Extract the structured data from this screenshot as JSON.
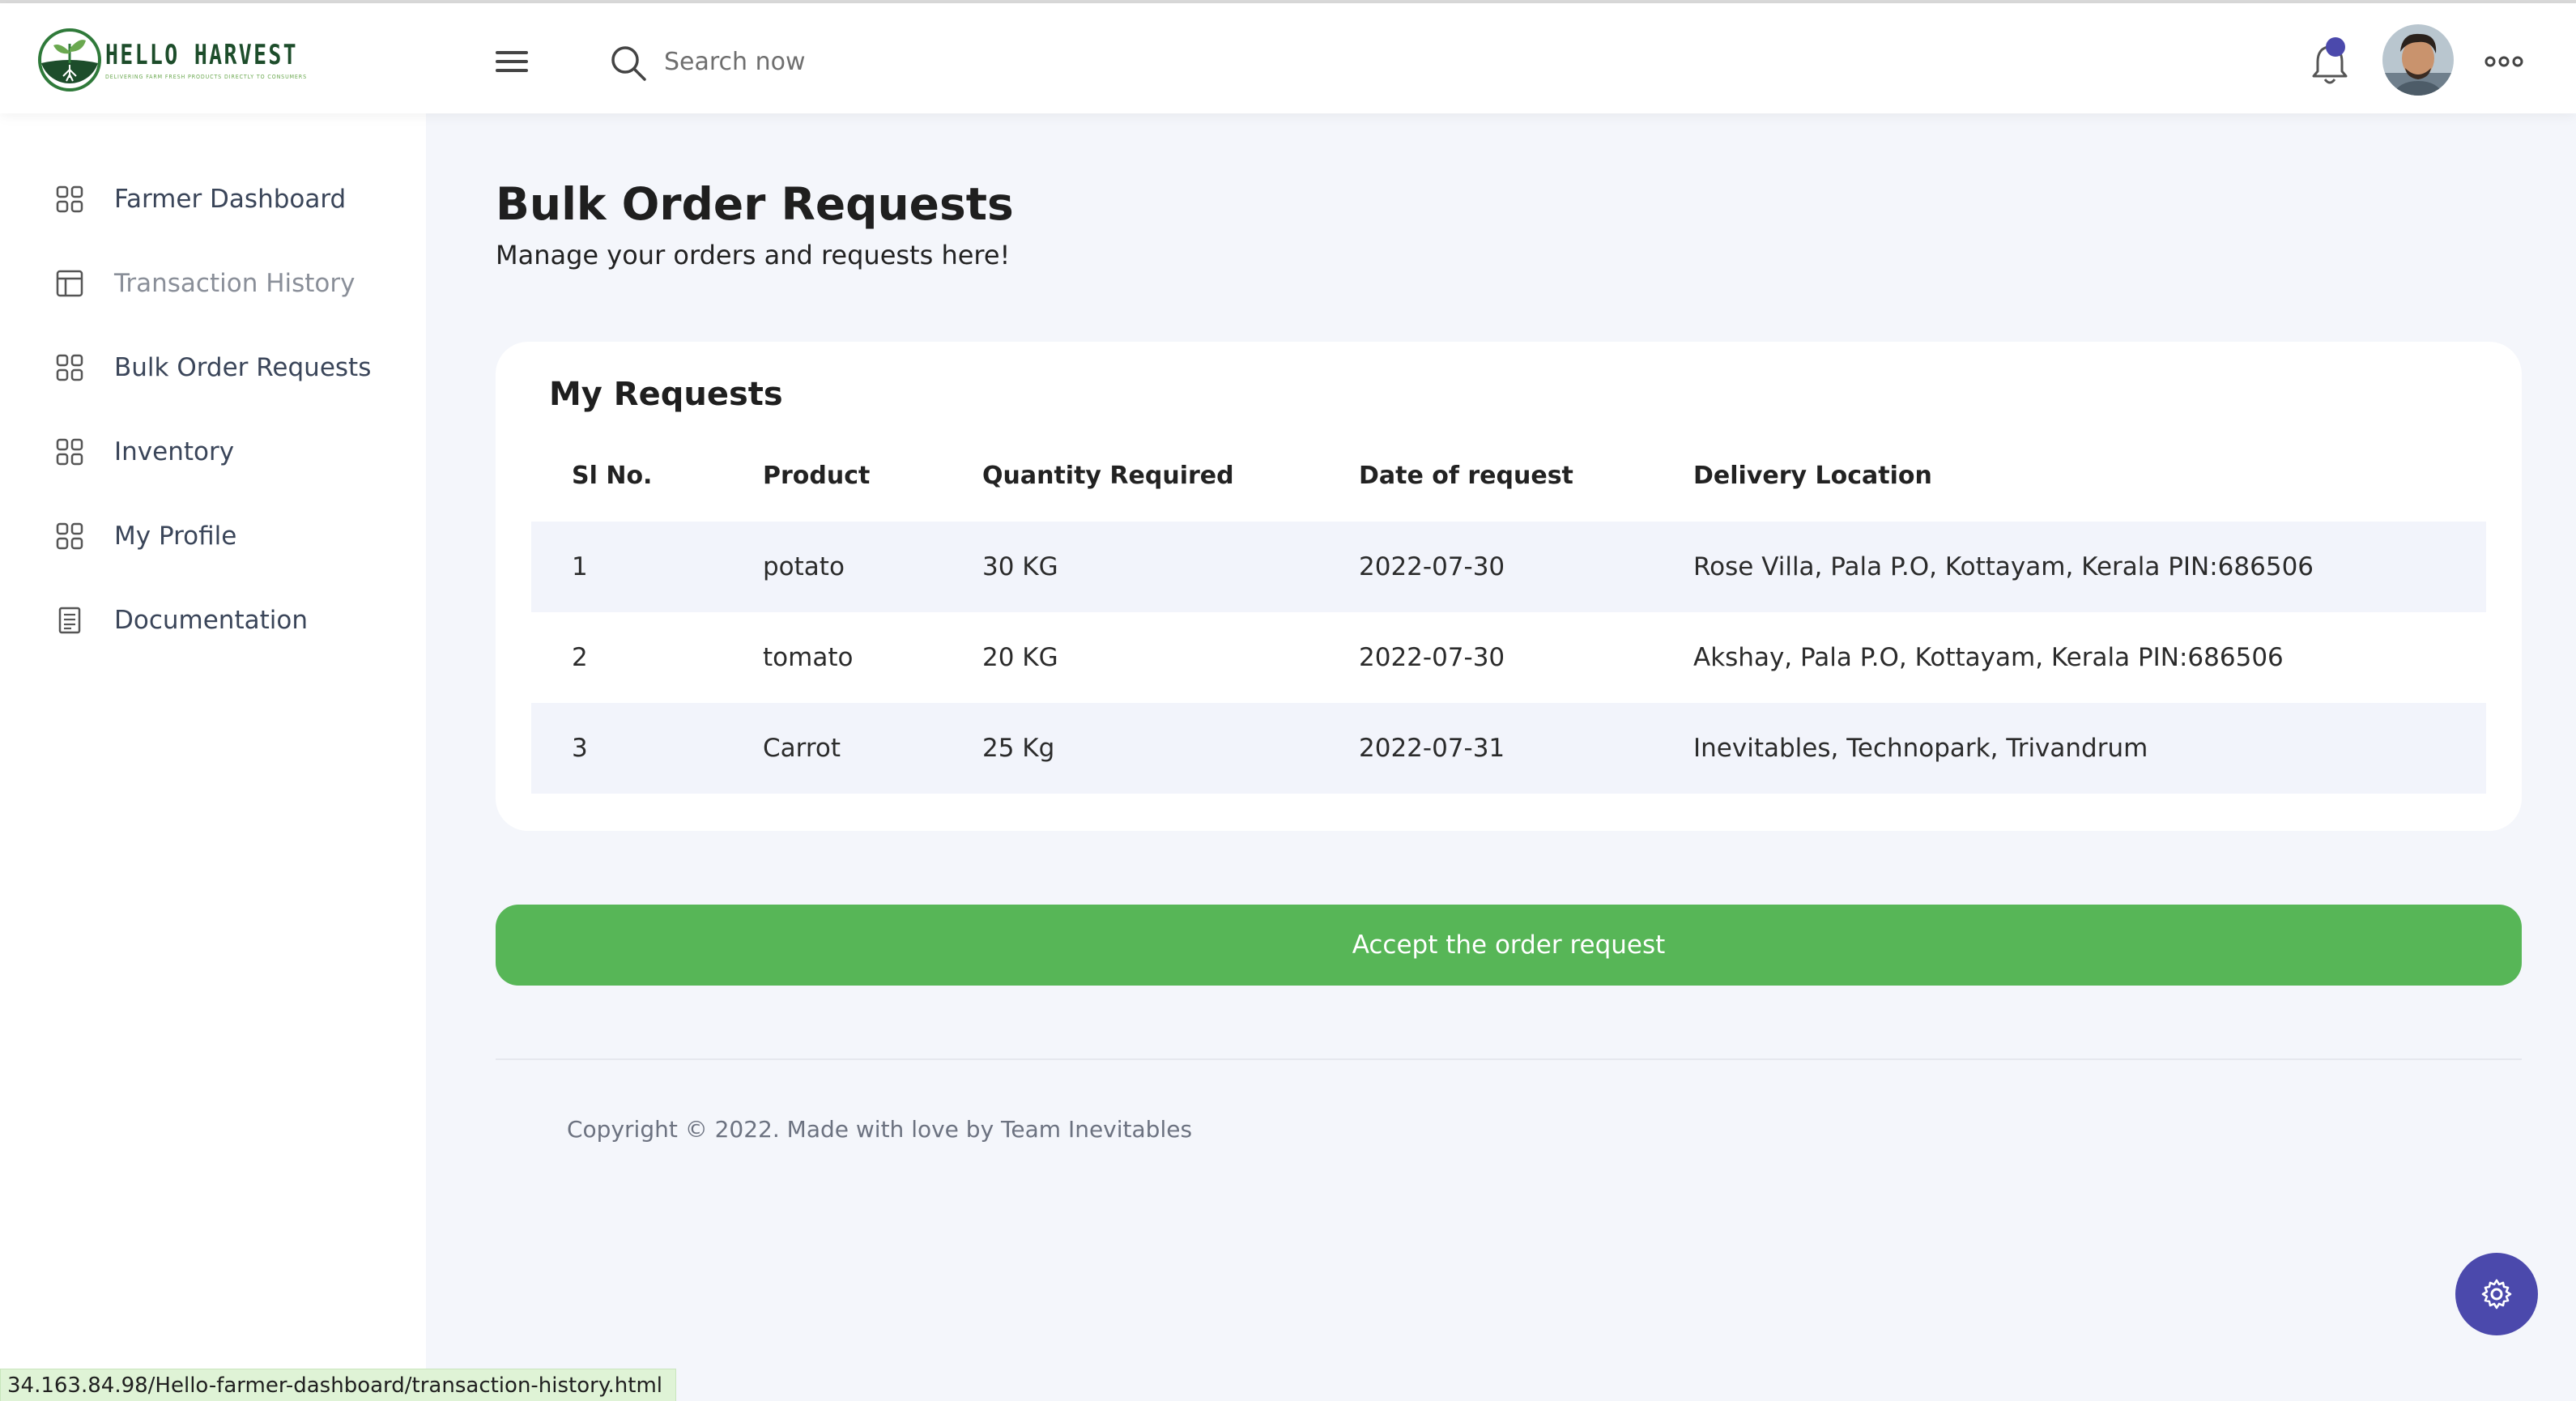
{
  "brand": {
    "name": "HELLO HARVEST",
    "tagline": "DELIVERING FARM FRESH PRODUCTS DIRECTLY TO CONSUMERS"
  },
  "header": {
    "search_placeholder": "Search now",
    "icons": [
      "menu-icon",
      "search-icon",
      "bell-icon",
      "avatar",
      "more-horizontal-icon"
    ]
  },
  "sidebar": {
    "items": [
      {
        "label": "Farmer Dashboard",
        "icon": "grid-icon"
      },
      {
        "label": "Transaction History",
        "icon": "layout-icon"
      },
      {
        "label": "Bulk Order Requests",
        "icon": "grid-icon"
      },
      {
        "label": "Inventory",
        "icon": "grid-icon"
      },
      {
        "label": "My Profile",
        "icon": "grid-icon"
      },
      {
        "label": "Documentation",
        "icon": "document-icon"
      }
    ]
  },
  "page": {
    "title": "Bulk Order Requests",
    "subtitle": "Manage your orders and requests here!"
  },
  "requests": {
    "title": "My Requests",
    "columns": [
      "Sl No.",
      "Product",
      "Quantity Required",
      "Date of request",
      "Delivery Location"
    ],
    "rows": [
      {
        "sl": "1",
        "product": "potato",
        "quantity": "30 KG",
        "date": "2022-07-30",
        "location": "Rose Villa, Pala P.O, Kottayam, Kerala PIN:686506"
      },
      {
        "sl": "2",
        "product": "tomato",
        "quantity": "20 KG",
        "date": "2022-07-30",
        "location": "Akshay, Pala P.O, Kottayam, Kerala PIN:686506"
      },
      {
        "sl": "3",
        "product": "Carrot",
        "quantity": "25 Kg",
        "date": "2022-07-31",
        "location": "Inevitables, Technopark, Trivandrum"
      }
    ]
  },
  "actions": {
    "accept_label": "Accept the order request"
  },
  "footer": {
    "copyright": "Copyright © 2022. Made with love by Team Inevitables"
  },
  "status_bar": {
    "url": "34.163.84.98/Hello-farmer-dashboard/transaction-history.html"
  },
  "colors": {
    "accent": "#4b49ac",
    "accept": "#57b657",
    "background": "#f4f6fb",
    "brand_green": "#1d4d2b"
  }
}
